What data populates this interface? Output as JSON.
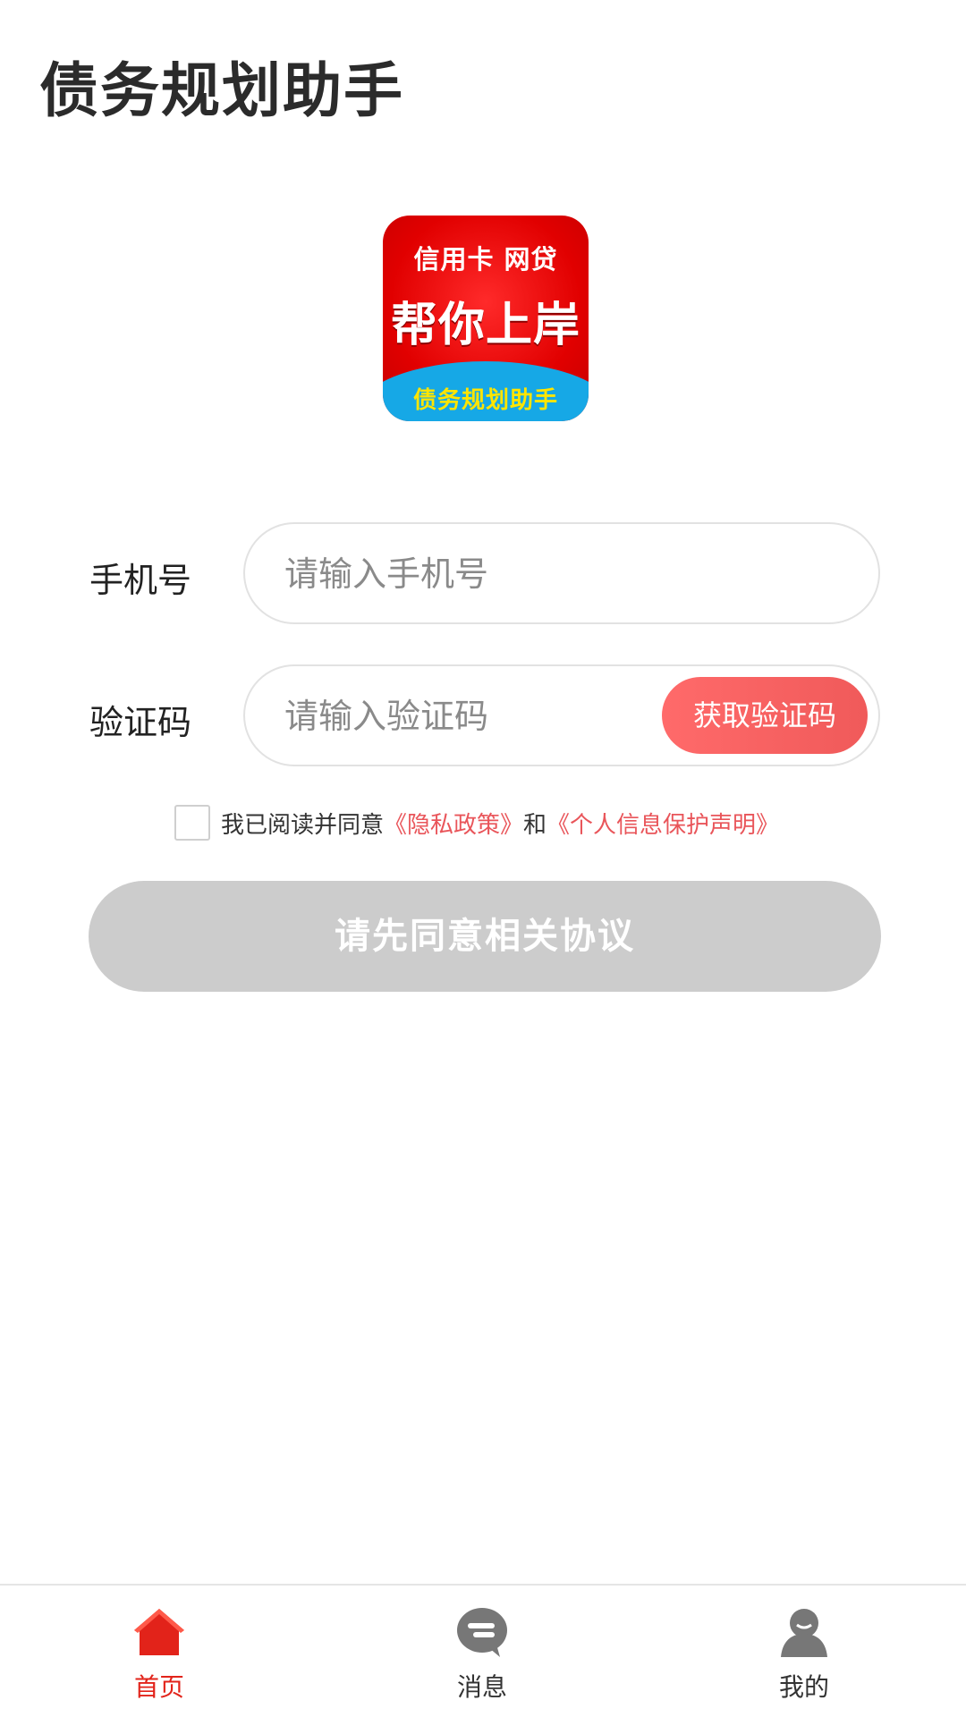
{
  "header": {
    "title": "债务规划助手"
  },
  "logo": {
    "line1": "信用卡  网贷",
    "line2": "帮你上岸",
    "line3": "债务规划助手"
  },
  "form": {
    "phone_label": "手机号",
    "phone_placeholder": "请输入手机号",
    "code_label": "验证码",
    "code_placeholder": "请输入验证码",
    "get_code_label": "获取验证码"
  },
  "agreement": {
    "text": "我已阅读并同意",
    "privacy_link": "《隐私政策》",
    "and": "和",
    "personal_info_link": "《个人信息保护声明》"
  },
  "submit_label": "请先同意相关协议",
  "bottom_nav": [
    {
      "label": "首页",
      "icon": "home-icon",
      "active": true
    },
    {
      "label": "消息",
      "icon": "message-icon",
      "active": false
    },
    {
      "label": "我的",
      "icon": "user-icon",
      "active": false
    }
  ],
  "colors": {
    "accent": "#e2231a",
    "button_gradient": "#f05a5a",
    "disabled": "#cccccc",
    "link": "#e9555a"
  }
}
